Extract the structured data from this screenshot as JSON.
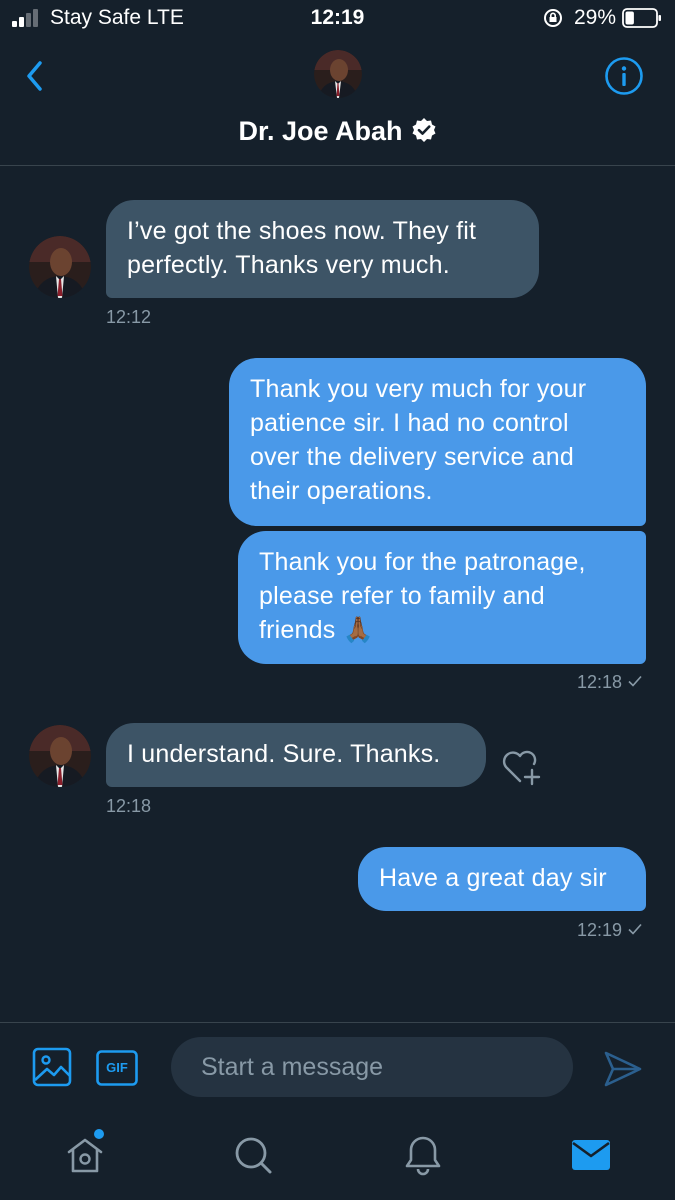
{
  "status_bar": {
    "carrier": "Stay Safe  LTE",
    "time": "12:19",
    "battery_percent": "29%",
    "battery_level": 0.29,
    "signal_bars_active": 2
  },
  "header": {
    "name": "Dr. Joe Abah",
    "verified": true
  },
  "messages": [
    {
      "direction": "incoming",
      "lines": [
        "I’ve got the shoes now. They fit",
        "perfectly. Thanks very much."
      ],
      "time": "12:12"
    },
    {
      "direction": "outgoing",
      "lines": [
        "Thank you very much for your",
        "patience sir. I had no control",
        "over the delivery service and",
        "their operations."
      ]
    },
    {
      "direction": "outgoing",
      "lines": [
        "Thank you for the patronage,",
        "please refer to family and",
        "friends 🙏🏾"
      ],
      "time": "12:18"
    },
    {
      "direction": "incoming",
      "lines": [
        "I understand. Sure. Thanks."
      ],
      "time": "12:18"
    },
    {
      "direction": "outgoing",
      "lines": [
        "Have a great day sir"
      ],
      "time": "12:19"
    }
  ],
  "composer": {
    "placeholder": "Start a message",
    "gif_label": "GIF"
  },
  "tabbar": {
    "items": [
      "home-icon",
      "search-icon",
      "notifications-icon",
      "messages-icon"
    ],
    "active": "messages-icon"
  },
  "colors": {
    "background": "#15202b",
    "incoming_bubble": "#3d5466",
    "outgoing_bubble": "#4a99e9",
    "accent": "#1d9bf0",
    "secondary_text": "#8899a6"
  }
}
